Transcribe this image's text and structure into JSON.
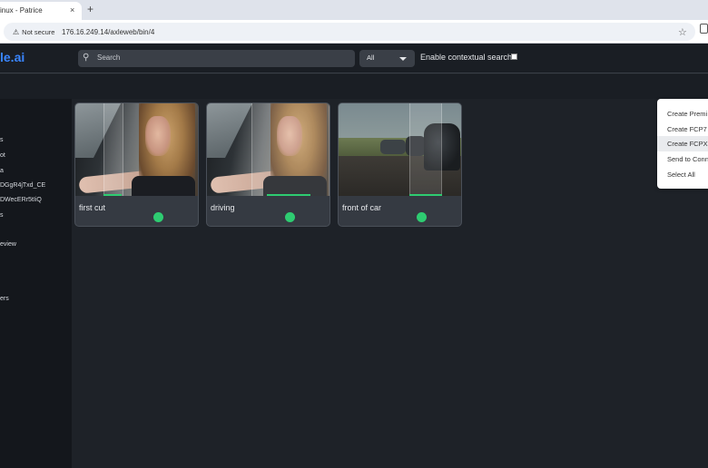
{
  "browser": {
    "tab_title": "inux - Patrice",
    "tab_close": "×",
    "new_tab": "+",
    "security_label": "Not secure",
    "url": "176.16.249.14/axleweb/bin/4"
  },
  "header": {
    "logo": "le.ai",
    "search_placeholder": "Search",
    "filter_value": "All",
    "contextual_label": "Enable contextual search",
    "contextual_checked": false
  },
  "sidebar": {
    "items": [
      "s",
      "ot",
      "a",
      "DGgR4jTxd_CE",
      "DWecERr5tIiQ",
      "s",
      "eview",
      "ers"
    ]
  },
  "cards": [
    {
      "title": "first cut",
      "status_color": "#2ecc71"
    },
    {
      "title": "driving",
      "status_color": "#2ecc71"
    },
    {
      "title": "front of car",
      "status_color": "#2ecc71"
    }
  ],
  "context_menu": {
    "items": [
      "Create Premi",
      "Create FCP7 ",
      "Create FCPX ",
      "Send to Conn",
      "Select All"
    ]
  },
  "colors": {
    "accent": "#3a86ff",
    "status": "#2ecc71",
    "background": "#1e2228",
    "sidebar": "#14171c"
  }
}
